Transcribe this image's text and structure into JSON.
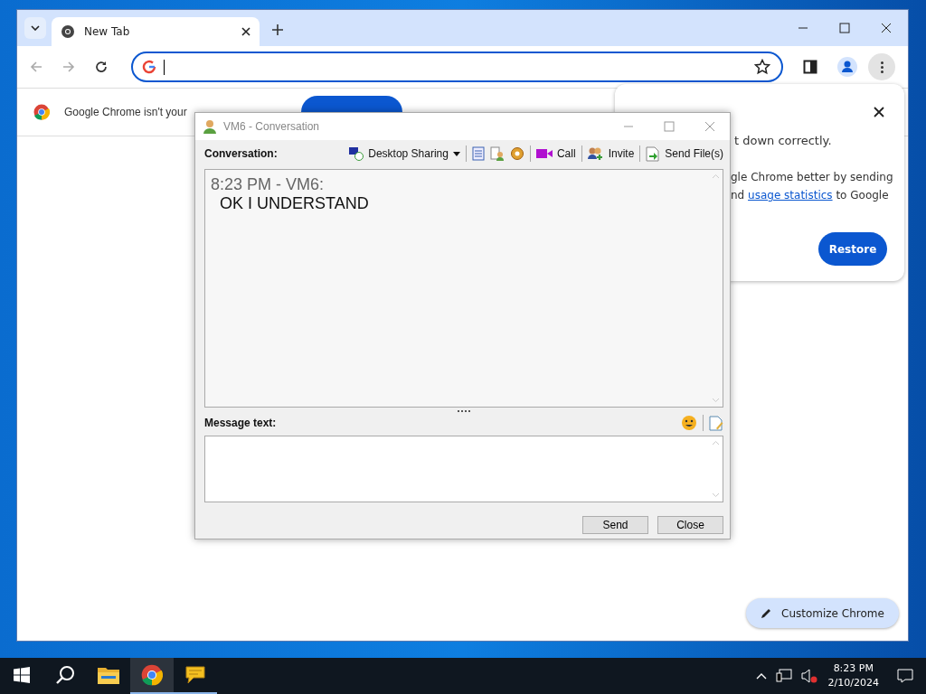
{
  "browser": {
    "tabs": [
      {
        "title": "New Tab",
        "selected": true
      }
    ],
    "infobar": {
      "message": "Google Chrome isn't your"
    },
    "restore_popup": {
      "lines": [
        "t down correctly.",
        "gle Chrome better by sending"
      ],
      "last_line": {
        "before": "nd ",
        "link": "usage statistics",
        "after": " to Google"
      },
      "button": "Restore"
    },
    "customize_button": "Customize Chrome"
  },
  "conversation": {
    "title": "VM6 - Conversation",
    "label": "Conversation:",
    "toolbar": [
      {
        "kind": "share",
        "label": "Desktop Sharing"
      },
      {
        "kind": "separator"
      },
      {
        "kind": "notes"
      },
      {
        "kind": "info"
      },
      {
        "kind": "plugin"
      },
      {
        "kind": "separator"
      },
      {
        "kind": "call",
        "label": "Call"
      },
      {
        "kind": "separator"
      },
      {
        "kind": "invite",
        "label": "Invite"
      },
      {
        "kind": "separator"
      },
      {
        "kind": "file",
        "label": "Send File(s)"
      }
    ],
    "messages": [
      {
        "header": "8:23 PM - VM6:",
        "text": "OK I UNDERSTAND"
      }
    ],
    "message_label": "Message text:",
    "buttons": [
      "Send",
      "Close"
    ]
  },
  "taskbar": {
    "apps": [
      {
        "kind": "explorer",
        "selected": false,
        "running": false
      },
      {
        "kind": "chrome",
        "selected": true,
        "running": true
      },
      {
        "kind": "chat",
        "selected": false,
        "running": true
      }
    ],
    "time": "8:23 PM",
    "date": "2/10/2024"
  }
}
